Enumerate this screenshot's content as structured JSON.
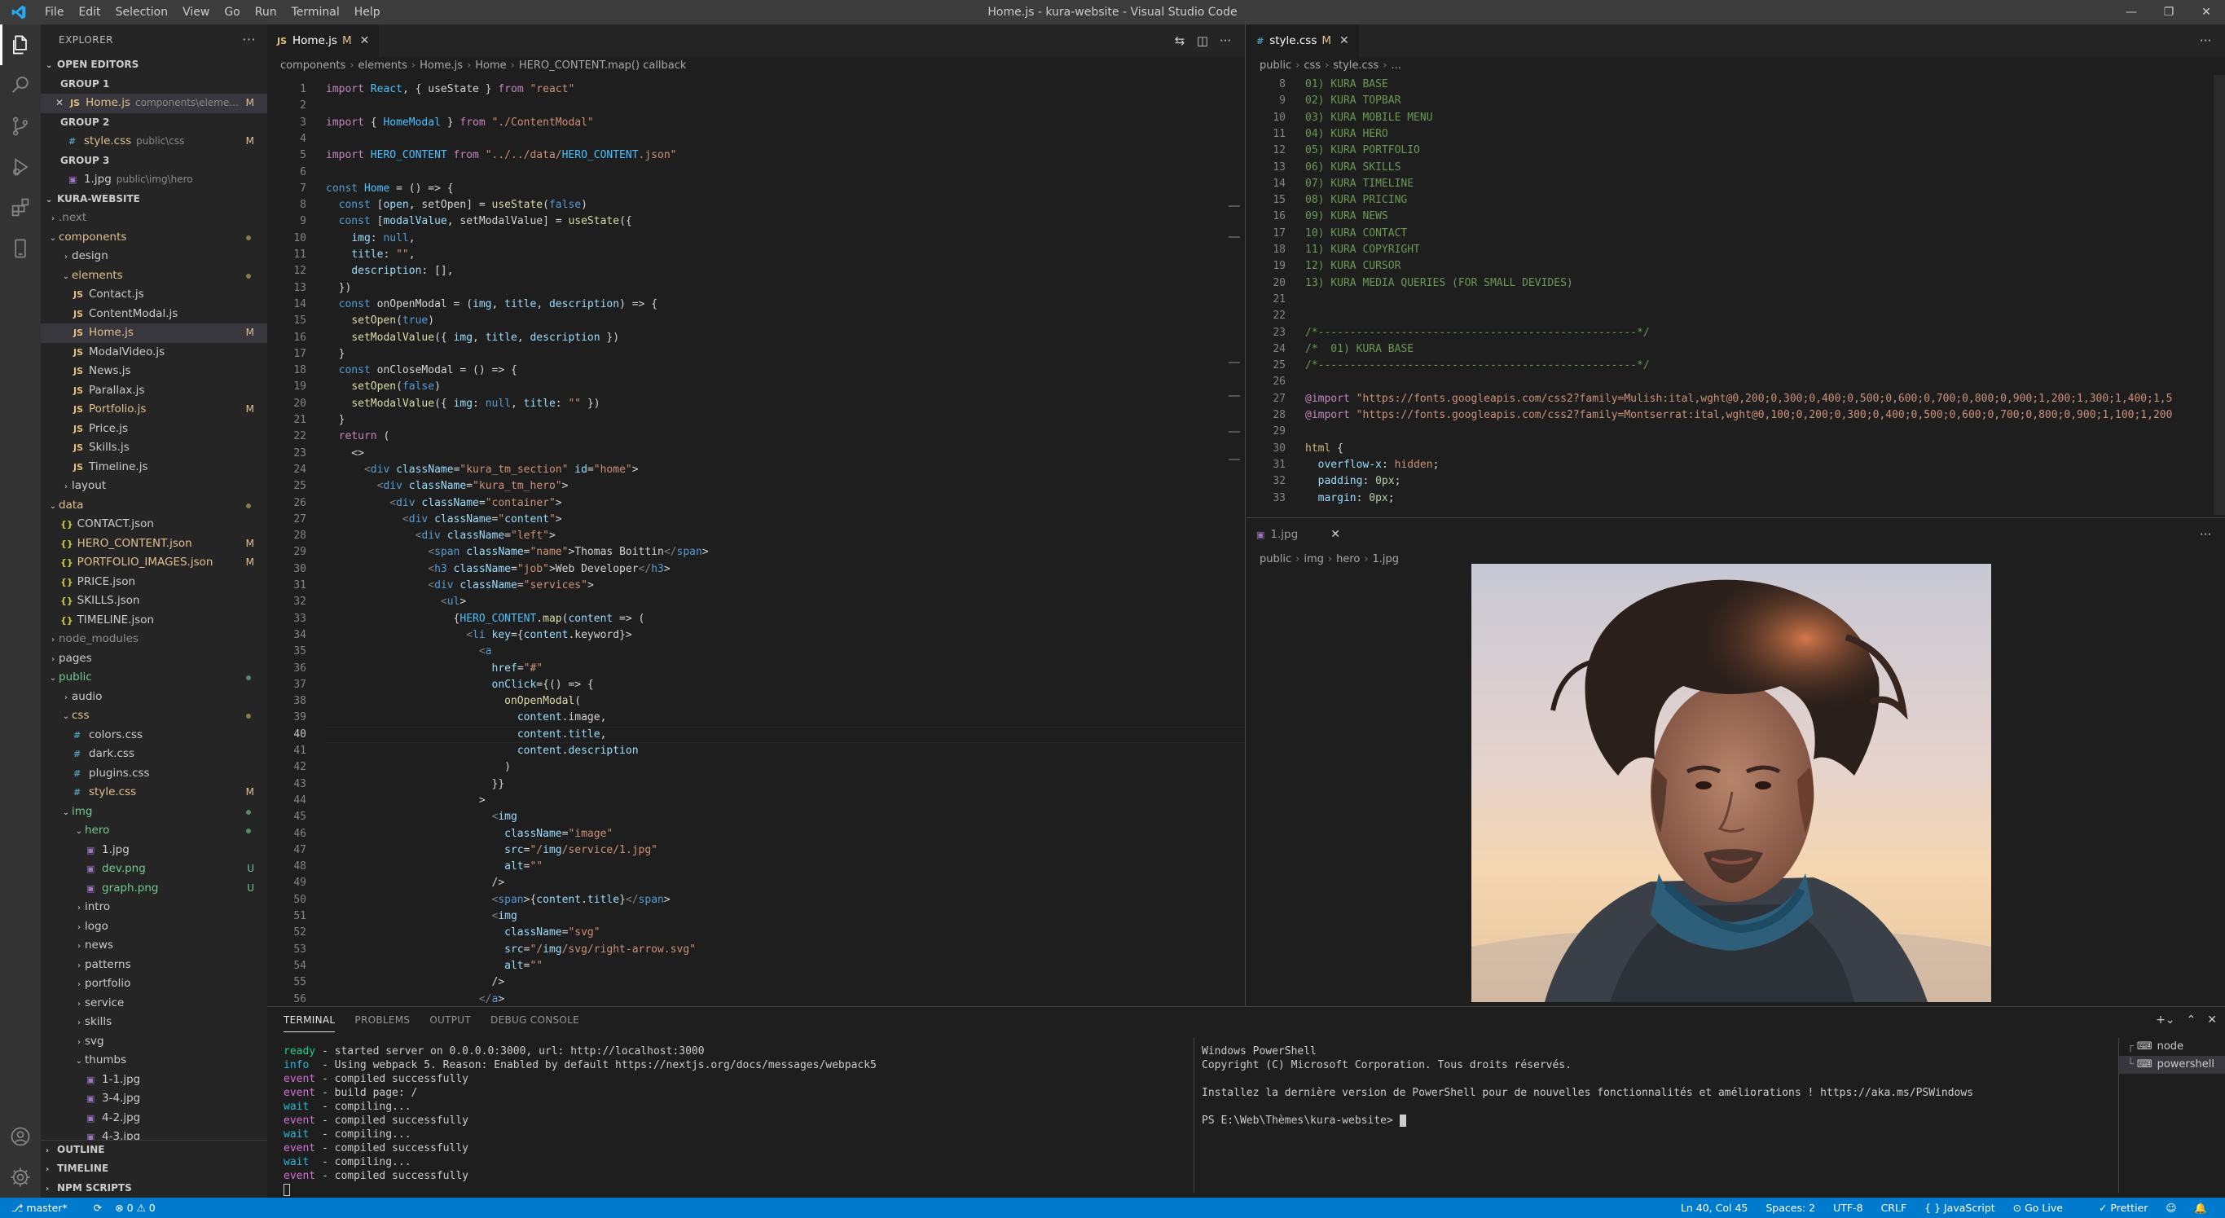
{
  "titlebar": {
    "title": "Home.js - kura-website - Visual Studio Code",
    "menu": [
      "File",
      "Edit",
      "Selection",
      "View",
      "Go",
      "Run",
      "Terminal",
      "Help"
    ]
  },
  "sidebar": {
    "header": "EXPLORER",
    "open_editors": {
      "label": "OPEN EDITORS",
      "groups": [
        {
          "label": "GROUP 1",
          "file": "Home.js",
          "path": "components\\eleme...",
          "badge": "M"
        },
        {
          "label": "GROUP 2",
          "file": "style.css",
          "path": "public\\css",
          "badge": "M"
        },
        {
          "label": "GROUP 3",
          "file": "1.jpg",
          "path": "public\\img\\hero",
          "badge": ""
        }
      ]
    },
    "project": "KURA-WEBSITE",
    "tree": [
      {
        "name": ".next",
        "kind": "folder",
        "depth": 1,
        "open": false,
        "status": "dim"
      },
      {
        "name": "components",
        "kind": "folder",
        "depth": 1,
        "open": true,
        "status": "mod-dot"
      },
      {
        "name": "design",
        "kind": "folder",
        "depth": 2,
        "open": false,
        "status": ""
      },
      {
        "name": "elements",
        "kind": "folder",
        "depth": 2,
        "open": true,
        "status": "mod-dot"
      },
      {
        "name": "Contact.js",
        "kind": "js",
        "depth": 3,
        "status": ""
      },
      {
        "name": "ContentModal.js",
        "kind": "js",
        "depth": 3,
        "status": ""
      },
      {
        "name": "Home.js",
        "kind": "js",
        "depth": 3,
        "status": "M",
        "selected": true
      },
      {
        "name": "ModalVideo.js",
        "kind": "js",
        "depth": 3,
        "status": ""
      },
      {
        "name": "News.js",
        "kind": "js",
        "depth": 3,
        "status": ""
      },
      {
        "name": "Parallax.js",
        "kind": "js",
        "depth": 3,
        "status": ""
      },
      {
        "name": "Portfolio.js",
        "kind": "js",
        "depth": 3,
        "status": "M"
      },
      {
        "name": "Price.js",
        "kind": "js",
        "depth": 3,
        "status": ""
      },
      {
        "name": "Skills.js",
        "kind": "js",
        "depth": 3,
        "status": ""
      },
      {
        "name": "Timeline.js",
        "kind": "js",
        "depth": 3,
        "status": ""
      },
      {
        "name": "layout",
        "kind": "folder",
        "depth": 2,
        "open": false,
        "status": ""
      },
      {
        "name": "data",
        "kind": "folder",
        "depth": 1,
        "open": true,
        "status": "mod-dot"
      },
      {
        "name": "CONTACT.json",
        "kind": "json",
        "depth": 2,
        "status": ""
      },
      {
        "name": "HERO_CONTENT.json",
        "kind": "json",
        "depth": 2,
        "status": "M"
      },
      {
        "name": "PORTFOLIO_IMAGES.json",
        "kind": "json",
        "depth": 2,
        "status": "M"
      },
      {
        "name": "PRICE.json",
        "kind": "json",
        "depth": 2,
        "status": ""
      },
      {
        "name": "SKILLS.json",
        "kind": "json",
        "depth": 2,
        "status": ""
      },
      {
        "name": "TIMELINE.json",
        "kind": "json",
        "depth": 2,
        "status": ""
      },
      {
        "name": "node_modules",
        "kind": "folder",
        "depth": 1,
        "open": false,
        "status": "dim"
      },
      {
        "name": "pages",
        "kind": "folder",
        "depth": 1,
        "open": false,
        "status": ""
      },
      {
        "name": "public",
        "kind": "folder",
        "depth": 1,
        "open": true,
        "status": "untr-dot"
      },
      {
        "name": "audio",
        "kind": "folder",
        "depth": 2,
        "open": false,
        "status": ""
      },
      {
        "name": "css",
        "kind": "folder",
        "depth": 2,
        "open": true,
        "status": "mod-dot"
      },
      {
        "name": "colors.css",
        "kind": "css",
        "depth": 3,
        "status": ""
      },
      {
        "name": "dark.css",
        "kind": "css",
        "depth": 3,
        "status": ""
      },
      {
        "name": "plugins.css",
        "kind": "css",
        "depth": 3,
        "status": ""
      },
      {
        "name": "style.css",
        "kind": "css",
        "depth": 3,
        "status": "M"
      },
      {
        "name": "img",
        "kind": "folder",
        "depth": 2,
        "open": true,
        "status": "untr-dot"
      },
      {
        "name": "hero",
        "kind": "folder",
        "depth": 3,
        "open": true,
        "status": "untr-dot"
      },
      {
        "name": "1.jpg",
        "kind": "img",
        "depth": 4,
        "status": ""
      },
      {
        "name": "dev.png",
        "kind": "img",
        "depth": 4,
        "status": "U"
      },
      {
        "name": "graph.png",
        "kind": "img",
        "depth": 4,
        "status": "U"
      },
      {
        "name": "intro",
        "kind": "folder",
        "depth": 3,
        "open": false,
        "status": ""
      },
      {
        "name": "logo",
        "kind": "folder",
        "depth": 3,
        "open": false,
        "status": ""
      },
      {
        "name": "news",
        "kind": "folder",
        "depth": 3,
        "open": false,
        "status": ""
      },
      {
        "name": "patterns",
        "kind": "folder",
        "depth": 3,
        "open": false,
        "status": ""
      },
      {
        "name": "portfolio",
        "kind": "folder",
        "depth": 3,
        "open": false,
        "status": ""
      },
      {
        "name": "service",
        "kind": "folder",
        "depth": 3,
        "open": false,
        "status": ""
      },
      {
        "name": "skills",
        "kind": "folder",
        "depth": 3,
        "open": false,
        "status": ""
      },
      {
        "name": "svg",
        "kind": "folder",
        "depth": 3,
        "open": false,
        "status": ""
      },
      {
        "name": "thumbs",
        "kind": "folder",
        "depth": 3,
        "open": true,
        "status": ""
      },
      {
        "name": "1-1.jpg",
        "kind": "img",
        "depth": 4,
        "status": ""
      },
      {
        "name": "3-4.jpg",
        "kind": "img",
        "depth": 4,
        "status": ""
      },
      {
        "name": "4-2.jpg",
        "kind": "img",
        "depth": 4,
        "status": ""
      },
      {
        "name": "4-3.jpg",
        "kind": "img",
        "depth": 4,
        "status": ""
      }
    ],
    "bottom_sections": [
      "OUTLINE",
      "TIMELINE",
      "NPM SCRIPTS"
    ]
  },
  "editor1": {
    "tab": {
      "label": "Home.js",
      "modified": "M"
    },
    "breadcrumb": [
      "components",
      "elements",
      "Home.js",
      "Home",
      "HERO_CONTENT.map() callback"
    ],
    "current_line": 40,
    "lines": [
      {
        "n": 1,
        "t": "import React, { useState } from \"react\""
      },
      {
        "n": 2,
        "t": ""
      },
      {
        "n": 3,
        "t": "import { HomeModal } from \"./ContentModal\""
      },
      {
        "n": 4,
        "t": ""
      },
      {
        "n": 5,
        "t": "import HERO_CONTENT from \"../../data/HERO_CONTENT.json\""
      },
      {
        "n": 6,
        "t": ""
      },
      {
        "n": 7,
        "t": "const Home = () => {"
      },
      {
        "n": 8,
        "t": "  const [open, setOpen] = useState(false)"
      },
      {
        "n": 9,
        "t": "  const [modalValue, setModalValue] = useState({"
      },
      {
        "n": 10,
        "t": "    img: null,"
      },
      {
        "n": 11,
        "t": "    title: \"\","
      },
      {
        "n": 12,
        "t": "    description: [],"
      },
      {
        "n": 13,
        "t": "  })"
      },
      {
        "n": 14,
        "t": "  const onOpenModal = (img, title, description) => {"
      },
      {
        "n": 15,
        "t": "    setOpen(true)"
      },
      {
        "n": 16,
        "t": "    setModalValue({ img, title, description })"
      },
      {
        "n": 17,
        "t": "  }"
      },
      {
        "n": 18,
        "t": "  const onCloseModal = () => {"
      },
      {
        "n": 19,
        "t": "    setOpen(false)"
      },
      {
        "n": 20,
        "t": "    setModalValue({ img: null, title: \"\" })"
      },
      {
        "n": 21,
        "t": "  }"
      },
      {
        "n": 22,
        "t": "  return ("
      },
      {
        "n": 23,
        "t": "    <>"
      },
      {
        "n": 24,
        "t": "      <div className=\"kura_tm_section\" id=\"home\">"
      },
      {
        "n": 25,
        "t": "        <div className=\"kura_tm_hero\">"
      },
      {
        "n": 26,
        "t": "          <div className=\"container\">"
      },
      {
        "n": 27,
        "t": "            <div className=\"content\">"
      },
      {
        "n": 28,
        "t": "              <div className=\"left\">"
      },
      {
        "n": 29,
        "t": "                <span className=\"name\">Thomas Boittin</span>"
      },
      {
        "n": 30,
        "t": "                <h3 className=\"job\">Web Developer</h3>"
      },
      {
        "n": 31,
        "t": "                <div className=\"services\">"
      },
      {
        "n": 32,
        "t": "                  <ul>"
      },
      {
        "n": 33,
        "t": "                    {HERO_CONTENT.map(content => ("
      },
      {
        "n": 34,
        "t": "                      <li key={content.keyword}>"
      },
      {
        "n": 35,
        "t": "                        <a"
      },
      {
        "n": 36,
        "t": "                          href=\"#\""
      },
      {
        "n": 37,
        "t": "                          onClick={() => {"
      },
      {
        "n": 38,
        "t": "                            onOpenModal("
      },
      {
        "n": 39,
        "t": "                              content.image,"
      },
      {
        "n": 40,
        "t": "                              content.title,"
      },
      {
        "n": 41,
        "t": "                              content.description"
      },
      {
        "n": 42,
        "t": "                            )"
      },
      {
        "n": 43,
        "t": "                          }}"
      },
      {
        "n": 44,
        "t": "                        >"
      },
      {
        "n": 45,
        "t": "                          <img"
      },
      {
        "n": 46,
        "t": "                            className=\"image\""
      },
      {
        "n": 47,
        "t": "                            src=\"/img/service/1.jpg\""
      },
      {
        "n": 48,
        "t": "                            alt=\"\""
      },
      {
        "n": 49,
        "t": "                          />"
      },
      {
        "n": 50,
        "t": "                          <span>{content.title}</span>"
      },
      {
        "n": 51,
        "t": "                          <img"
      },
      {
        "n": 52,
        "t": "                            className=\"svg\""
      },
      {
        "n": 53,
        "t": "                            src=\"/img/svg/right-arrow.svg\""
      },
      {
        "n": 54,
        "t": "                            alt=\"\""
      },
      {
        "n": 55,
        "t": "                          />"
      },
      {
        "n": 56,
        "t": "                        </a>"
      }
    ]
  },
  "editor2": {
    "tab": {
      "label": "style.css",
      "modified": "M"
    },
    "breadcrumb": [
      "public",
      "css",
      "style.css",
      "..."
    ],
    "lines": [
      {
        "n": 8,
        "t": "01) KURA BASE"
      },
      {
        "n": 9,
        "t": "02) KURA TOPBAR"
      },
      {
        "n": 10,
        "t": "03) KURA MOBILE MENU"
      },
      {
        "n": 11,
        "t": "04) KURA HERO"
      },
      {
        "n": 12,
        "t": "05) KURA PORTFOLIO"
      },
      {
        "n": 13,
        "t": "06) KURA SKILLS"
      },
      {
        "n": 14,
        "t": "07) KURA TIMELINE"
      },
      {
        "n": 15,
        "t": "08) KURA PRICING"
      },
      {
        "n": 16,
        "t": "09) KURA NEWS"
      },
      {
        "n": 17,
        "t": "10) KURA CONTACT"
      },
      {
        "n": 18,
        "t": "11) KURA COPYRIGHT"
      },
      {
        "n": 19,
        "t": "12) KURA CURSOR"
      },
      {
        "n": 20,
        "t": "13) KURA MEDIA QUERIES (FOR SMALL DEVIDES)"
      },
      {
        "n": 21,
        "t": ""
      },
      {
        "n": 22,
        "t": ""
      },
      {
        "n": 23,
        "t": "/*--------------------------------------------------*/"
      },
      {
        "n": 24,
        "t": "/*  01) KURA BASE"
      },
      {
        "n": 25,
        "t": "/*--------------------------------------------------*/"
      },
      {
        "n": 26,
        "t": ""
      },
      {
        "n": 27,
        "t": "@import \"https://fonts.googleapis.com/css2?family=Mulish:ital,wght@0,200;0,300;0,400;0,500;0,600;0,700;0,800;0,900;1,200;1,300;1,400;1,5"
      },
      {
        "n": 28,
        "t": "@import \"https://fonts.googleapis.com/css2?family=Montserrat:ital,wght@0,100;0,200;0,300;0,400;0,500;0,600;0,700;0,800;0,900;1,100;1,200"
      },
      {
        "n": 29,
        "t": ""
      },
      {
        "n": 30,
        "t": "html {"
      },
      {
        "n": 31,
        "t": "  overflow-x: hidden;"
      },
      {
        "n": 32,
        "t": "  padding: 0px;"
      },
      {
        "n": 33,
        "t": "  margin: 0px;"
      }
    ]
  },
  "editor3": {
    "tab": {
      "label": "1.jpg"
    },
    "breadcrumb": [
      "public",
      "img",
      "hero",
      "1.jpg"
    ]
  },
  "panel": {
    "tabs": [
      "TERMINAL",
      "PROBLEMS",
      "OUTPUT",
      "DEBUG CONSOLE"
    ],
    "active_tab": "TERMINAL",
    "terminal1": [
      {
        "k": "ready",
        "c": "green",
        "t": " - started server on 0.0.0.0:3000, url: http://localhost:3000"
      },
      {
        "k": "info",
        "c": "cyan",
        "t": "  - Using webpack 5. Reason: Enabled by default https://nextjs.org/docs/messages/webpack5"
      },
      {
        "k": "event",
        "c": "mag",
        "t": " - compiled successfully"
      },
      {
        "k": "event",
        "c": "mag",
        "t": " - build page: /"
      },
      {
        "k": "wait",
        "c": "cyan",
        "t": "  - compiling..."
      },
      {
        "k": "event",
        "c": "mag",
        "t": " - compiled successfully"
      },
      {
        "k": "wait",
        "c": "cyan",
        "t": "  - compiling..."
      },
      {
        "k": "event",
        "c": "mag",
        "t": " - compiled successfully"
      },
      {
        "k": "wait",
        "c": "cyan",
        "t": "  - compiling..."
      },
      {
        "k": "event",
        "c": "mag",
        "t": " - compiled successfully"
      }
    ],
    "terminal2": [
      "Windows PowerShell",
      "Copyright (C) Microsoft Corporation. Tous droits réservés.",
      "",
      "Installez la dernière version de PowerShell pour de nouvelles fonctionnalités et améliorations ! https://aka.ms/PSWindows",
      "",
      "PS E:\\Web\\Thèmes\\kura-website> "
    ],
    "terminal_list": [
      "node",
      "powershell"
    ]
  },
  "statusbar": {
    "branch": "master*",
    "sync": "⟳",
    "problems": "⊗ 0 ⚠ 0",
    "position": "Ln 40, Col 45",
    "spaces": "Spaces: 2",
    "encoding": "UTF-8",
    "eol": "CRLF",
    "language": "{ } JavaScript",
    "golive": "Go Live",
    "prettier": "✓ Prettier"
  }
}
